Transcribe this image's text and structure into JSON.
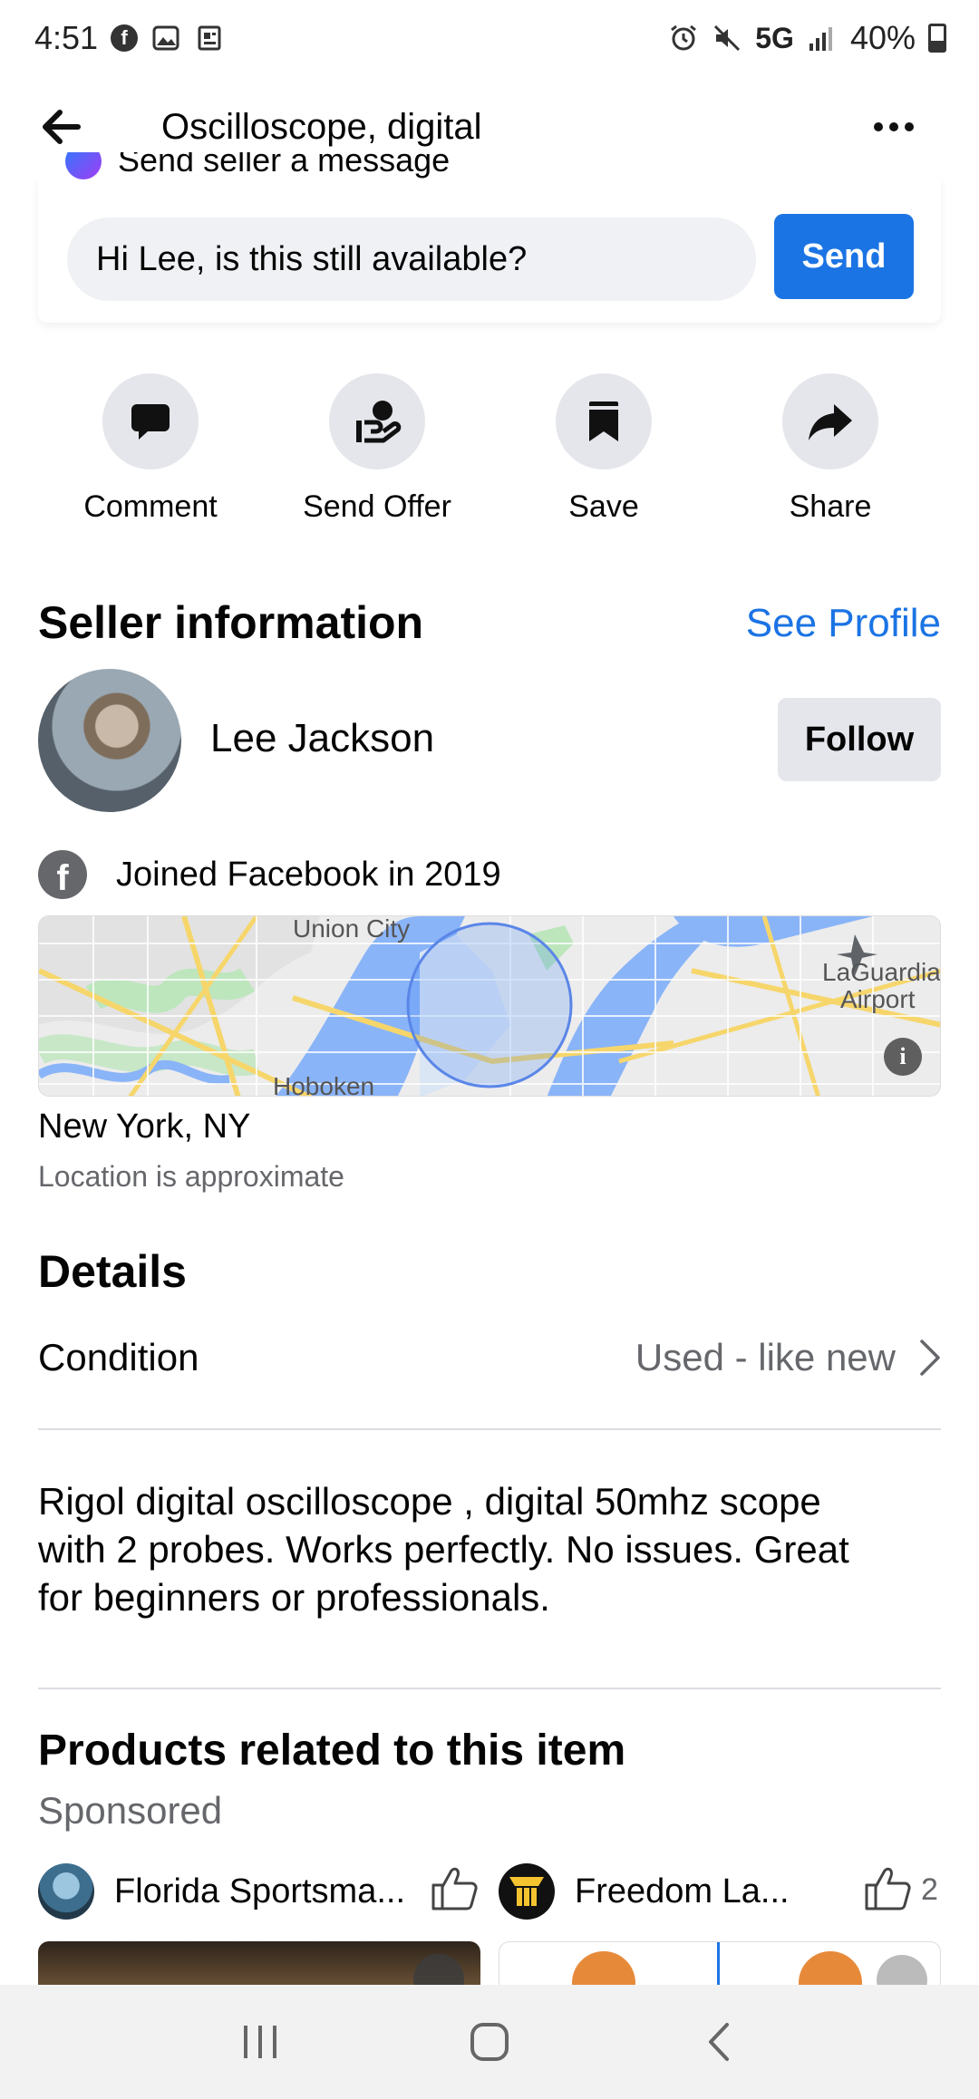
{
  "status_bar": {
    "time": "4:51",
    "network": "5G",
    "battery": "40%"
  },
  "header": {
    "title": "Oscilloscope, digital"
  },
  "message": {
    "peek_text": "Send seller a message",
    "input_value": "Hi Lee, is this still available?",
    "send_label": "Send"
  },
  "actions": [
    {
      "label": "Comment",
      "icon": "comment-icon"
    },
    {
      "label": "Send Offer",
      "icon": "send-offer-icon"
    },
    {
      "label": "Save",
      "icon": "bookmark-icon"
    },
    {
      "label": "Share",
      "icon": "share-icon"
    }
  ],
  "seller": {
    "section_title": "Seller information",
    "see_profile": "See Profile",
    "name": "Lee Jackson",
    "follow_label": "Follow",
    "joined": "Joined Facebook in 2019"
  },
  "map": {
    "labels": [
      "Union City",
      "LaGuardia",
      "Airport",
      "Hoboken"
    ],
    "info": "i"
  },
  "location": {
    "name": "New York, NY",
    "note": "Location is approximate"
  },
  "details": {
    "section_title": "Details",
    "condition_label": "Condition",
    "condition_value": "Used - like new",
    "description": "Rigol digital oscilloscope , digital 50mhz scope\nwith 2 probes. Works perfectly.  No issues. Great\nfor beginners or professionals."
  },
  "products": {
    "section_title": "Products related to this item",
    "sponsored": "Sponsored",
    "items": [
      {
        "name": "Florida Sportsma...",
        "likes": ""
      },
      {
        "name": "Freedom La...",
        "likes": "2"
      }
    ]
  },
  "colors": {
    "accent": "#1b74e4",
    "secondary_text": "#65676b",
    "button_gray": "#e4e6eb"
  }
}
